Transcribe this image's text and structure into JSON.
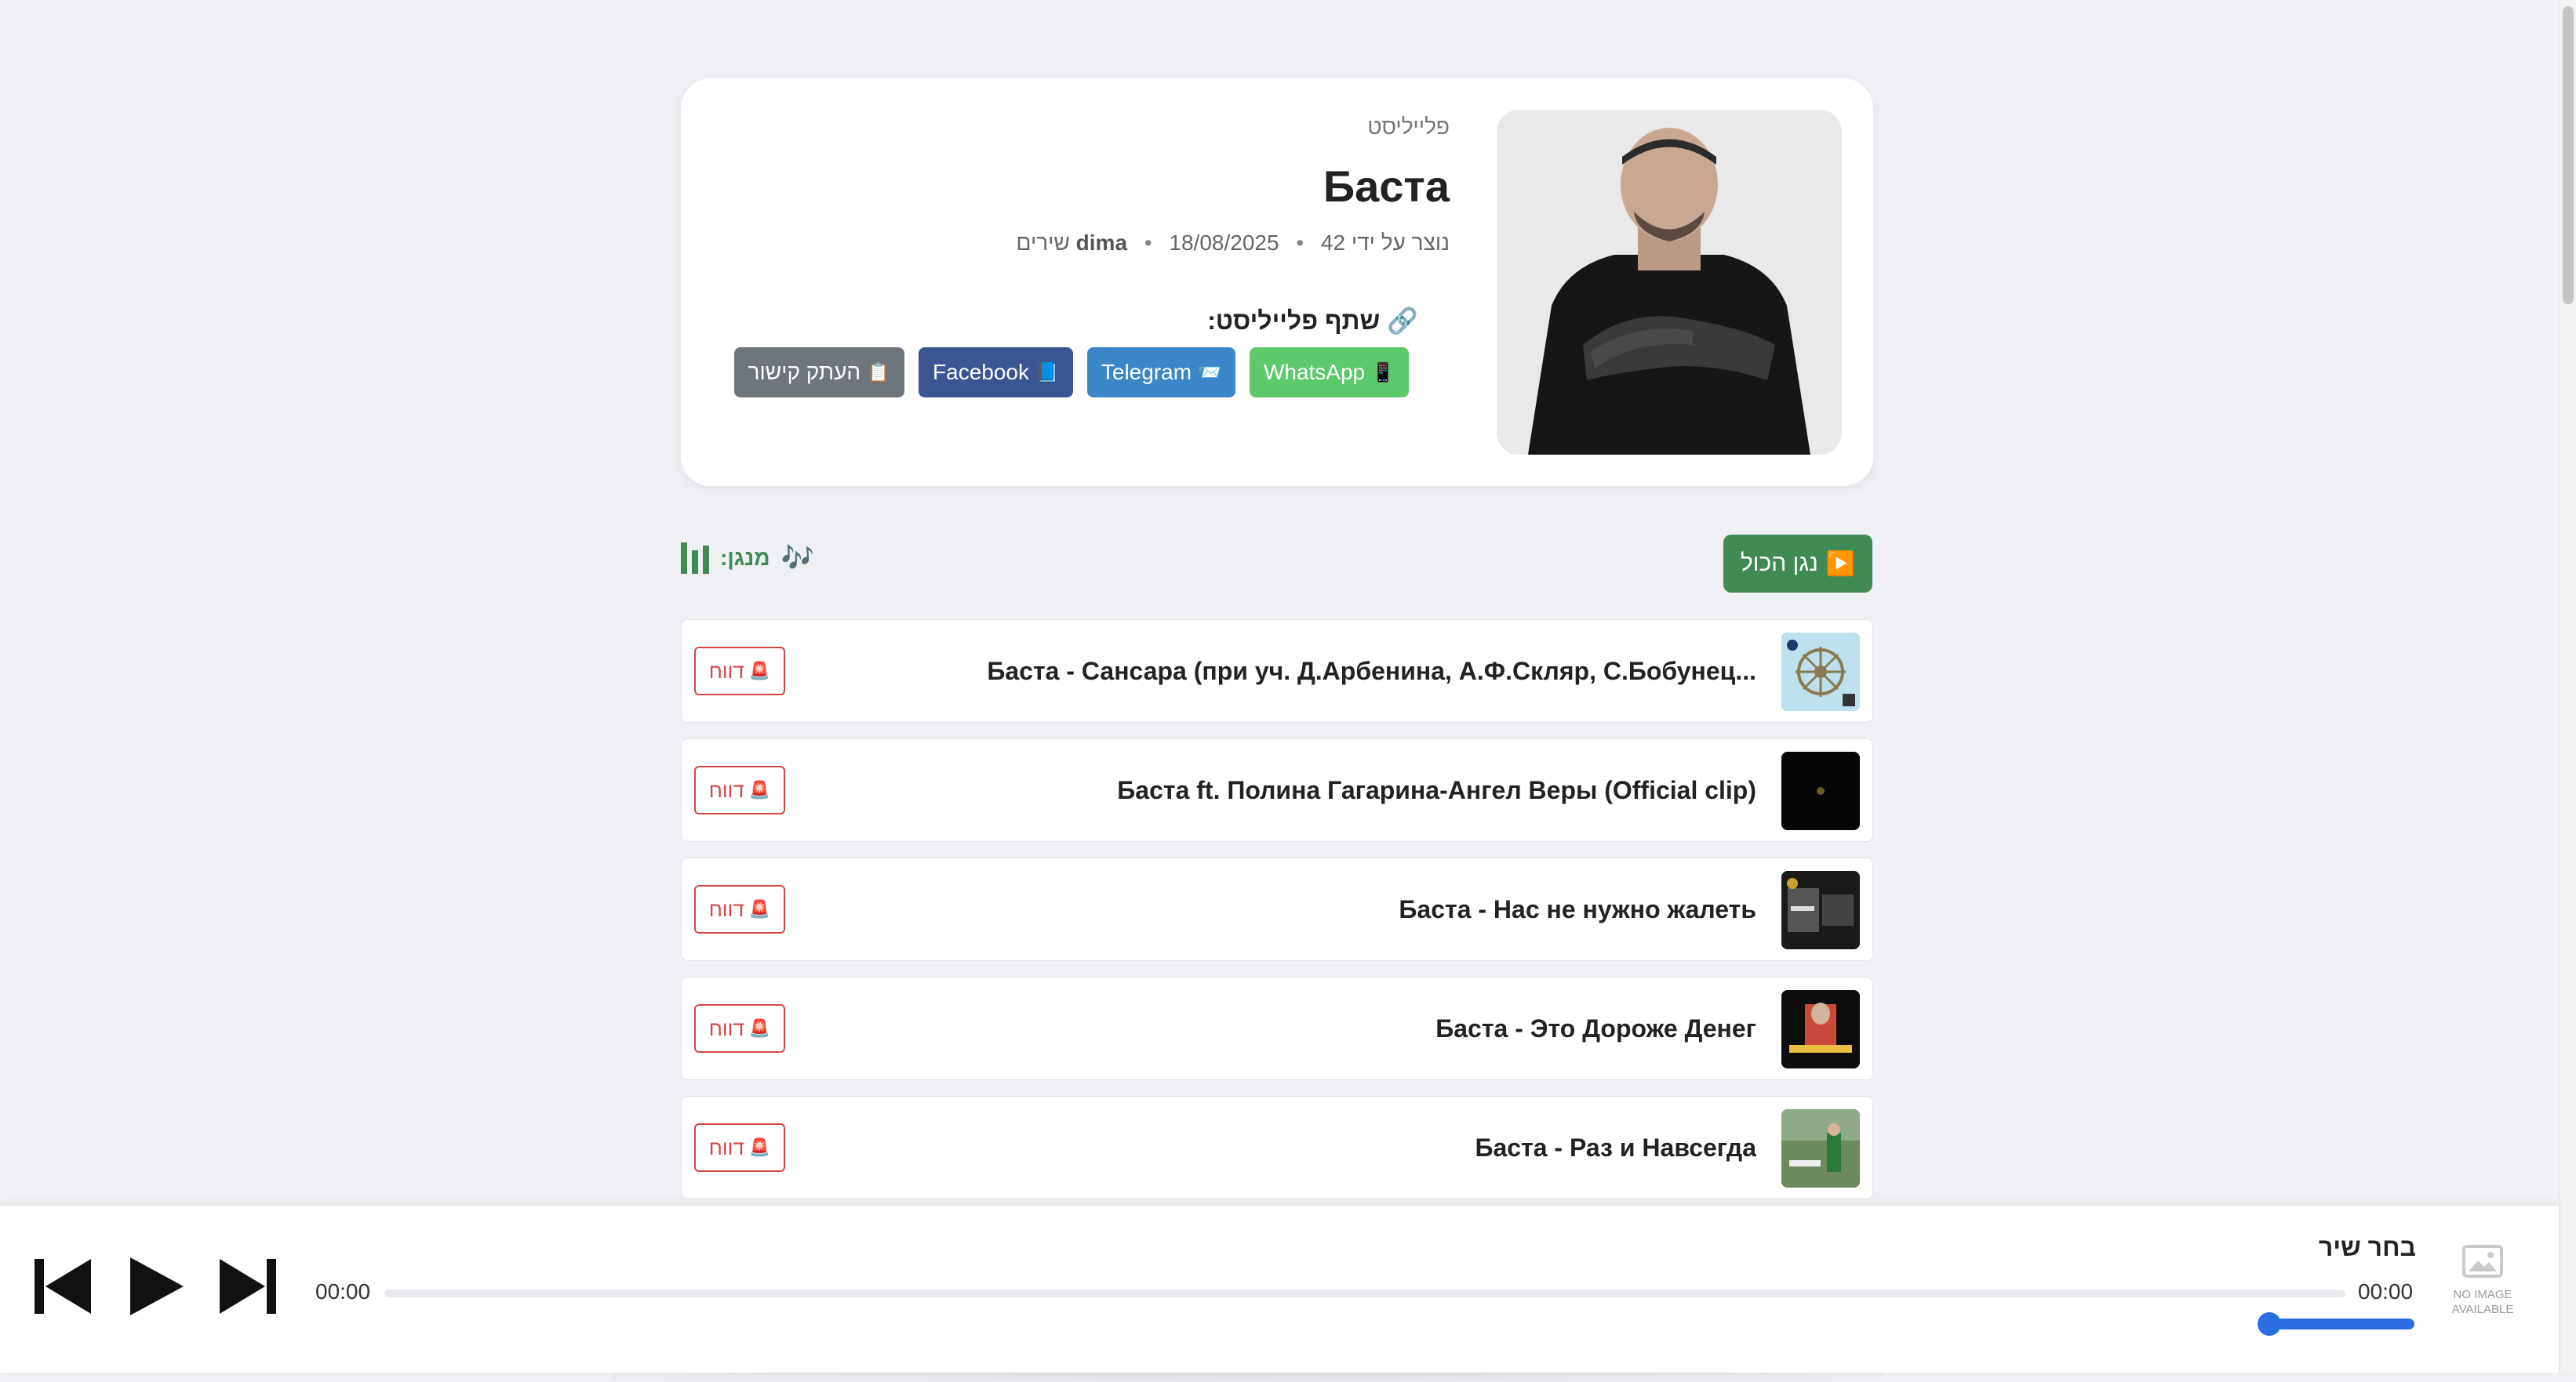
{
  "playlist": {
    "type_label": "פלייליסט",
    "title": "Баста",
    "created_by_prefix": "נוצר על ידי",
    "creator": "dima",
    "date": "18/08/2025",
    "song_count": "42 שירים",
    "share_label": "🔗 שתף פלייליסט:",
    "share_buttons": [
      {
        "label": "WhatsApp",
        "icon": "📱",
        "color": "#5cc96a"
      },
      {
        "label": "Telegram",
        "icon": "📨",
        "color": "#3b86c8"
      },
      {
        "label": "Facebook",
        "icon": "📘",
        "color": "#3c5595"
      },
      {
        "label": "העתק קישור",
        "icon": "📋",
        "color": "#6e757d"
      }
    ]
  },
  "controls": {
    "play_all": "נגן הכול",
    "play_all_icon": "▶️",
    "now_playing_label": "מנגן:",
    "now_playing_icon": "🎶"
  },
  "tracks": [
    {
      "title": "Баста - Сансара (при уч. Д.Арбенина, А.Ф.Скляр, С.Бобунец...",
      "report": "דווח"
    },
    {
      "title": "Баста ft. Полина Гагарина-Ангел Веры (Official clip)",
      "report": "דווח"
    },
    {
      "title": "Баста - Нас не нужно жалеть",
      "report": "דווח"
    },
    {
      "title": "Баста - Это Дороже Денег",
      "report": "דווח"
    },
    {
      "title": "Баста - Раз и Навсегда",
      "report": "דווח"
    }
  ],
  "report_icon": "🚨",
  "player": {
    "song_label": "בחר שיר",
    "current_time": "00:00",
    "duration": "00:00",
    "progress": 0,
    "volume": 0,
    "no_image_line1": "NO IMAGE",
    "no_image_line2": "AVAILABLE"
  },
  "colors": {
    "accent_green": "#3f8a55",
    "report_red": "#d64545",
    "volume_blue": "#2d6fe0"
  }
}
